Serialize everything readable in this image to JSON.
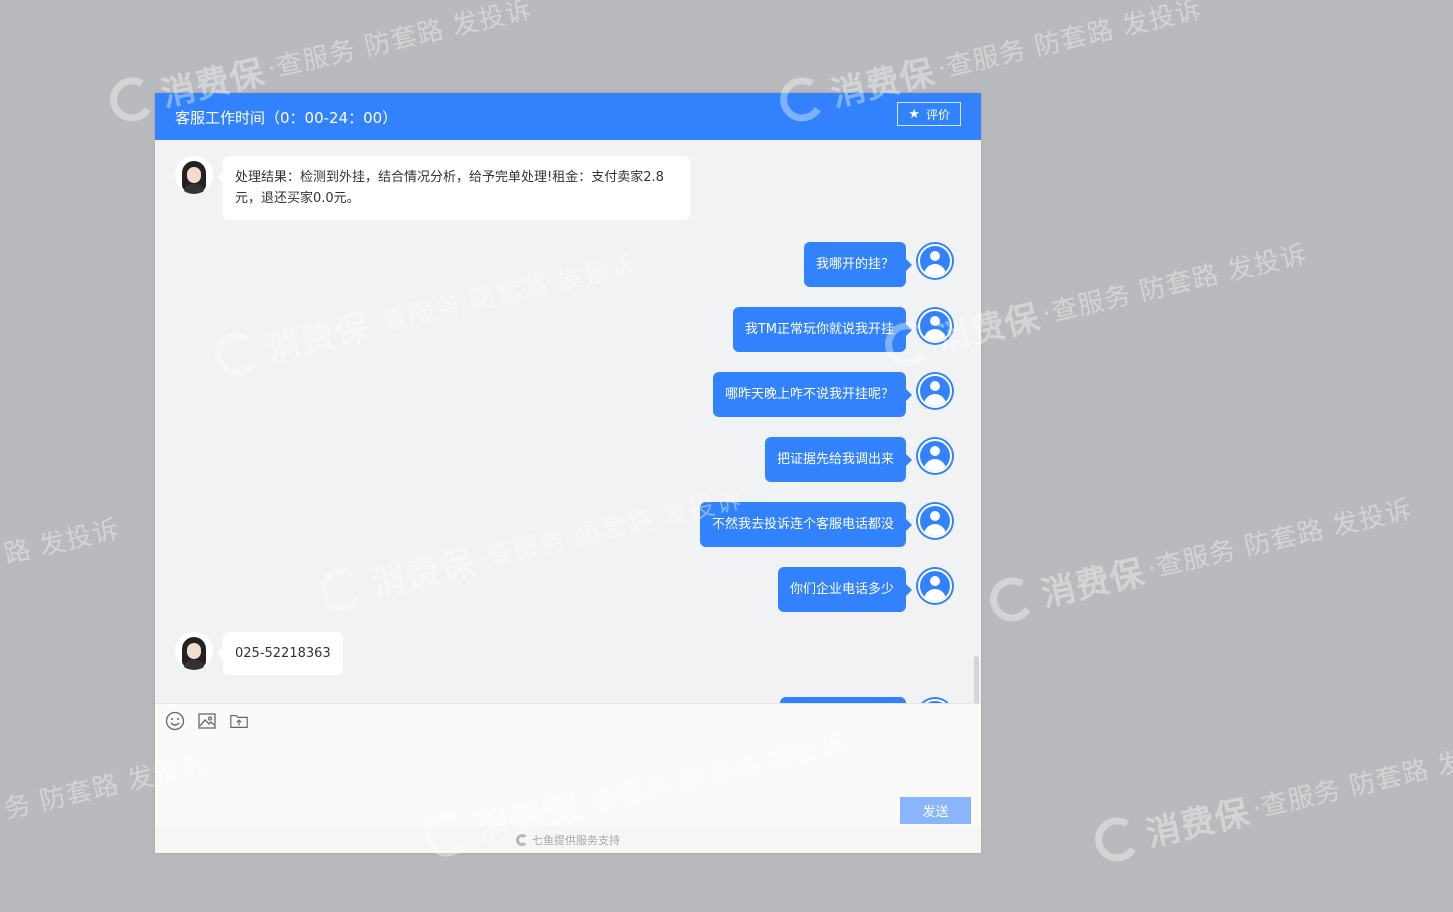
{
  "header": {
    "title": "客服工作时间（0：00-24：00）",
    "rate_label": "评价"
  },
  "messages": [
    {
      "side": "agent",
      "text": "处理结果：检测到外挂，结合情况分析，给予完单处理!租金：支付卖家2.8元，退还买家0.0元。"
    },
    {
      "side": "user",
      "text": "我哪开的挂？"
    },
    {
      "side": "user",
      "text": "我TM正常玩你就说我开挂"
    },
    {
      "side": "user",
      "text": "哪昨天晚上咋不说我开挂呢？"
    },
    {
      "side": "user",
      "text": "把证据先给我调出来"
    },
    {
      "side": "user",
      "text": "不然我去投诉连个客服电话都没"
    },
    {
      "side": "user",
      "text": "你们企业电话多少"
    },
    {
      "side": "agent",
      "text": "025-52218363"
    }
  ],
  "composer": {
    "send_label": "发送"
  },
  "footer": {
    "text": "七鱼提供服务支持"
  },
  "watermark": {
    "brand": "消费保",
    "slogan": "·查服务 防套路 发投诉",
    "fragment_a": "路 发投诉",
    "fragment_b": "务 防套路 发投诉",
    "fragment_c": "·查服务 防套路"
  },
  "colors": {
    "accent": "#3382fd",
    "background": "#b9babd",
    "send_button": "#8bb5fb"
  },
  "icons": [
    "star-icon",
    "emoji-icon",
    "image-icon",
    "upload-icon",
    "qiyu-logo-icon"
  ]
}
